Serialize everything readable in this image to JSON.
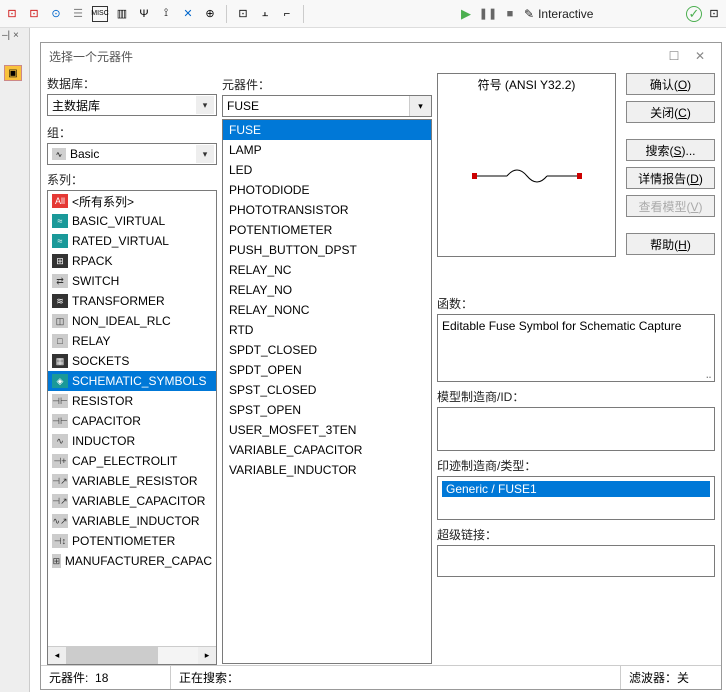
{
  "toolbar": {
    "interactive_label": "Interactive"
  },
  "dialog": {
    "title": "选择一个元器件",
    "database_label": "数据库：",
    "database_value": "主数据库",
    "group_label": "组：",
    "group_value": "Basic",
    "family_label": "系列：",
    "component_label": "元器件：",
    "component_value": "FUSE",
    "symbol_label": "符号 (ANSI Y32.2)",
    "families": [
      {
        "icon": "All",
        "cls": "red",
        "label": "<所有系列>"
      },
      {
        "icon": "≈",
        "cls": "",
        "label": "BASIC_VIRTUAL"
      },
      {
        "icon": "≈",
        "cls": "",
        "label": "RATED_VIRTUAL"
      },
      {
        "icon": "⊞",
        "cls": "dark",
        "label": "RPACK"
      },
      {
        "icon": "⇄",
        "cls": "gray",
        "label": "SWITCH"
      },
      {
        "icon": "≋",
        "cls": "dark",
        "label": "TRANSFORMER"
      },
      {
        "icon": "◫",
        "cls": "gray",
        "label": "NON_IDEAL_RLC"
      },
      {
        "icon": "□",
        "cls": "gray",
        "label": "RELAY"
      },
      {
        "icon": "▦",
        "cls": "dark",
        "label": "SOCKETS"
      },
      {
        "icon": "◈",
        "cls": "",
        "label": "SCHEMATIC_SYMBOLS",
        "selected": true
      },
      {
        "icon": "⊣⊢",
        "cls": "gray",
        "label": "RESISTOR"
      },
      {
        "icon": "⊣⊢",
        "cls": "gray",
        "label": "CAPACITOR"
      },
      {
        "icon": "∿",
        "cls": "gray",
        "label": "INDUCTOR"
      },
      {
        "icon": "⊣+",
        "cls": "gray",
        "label": "CAP_ELECTROLIT"
      },
      {
        "icon": "⊣↗",
        "cls": "gray",
        "label": "VARIABLE_RESISTOR"
      },
      {
        "icon": "⊣↗",
        "cls": "gray",
        "label": "VARIABLE_CAPACITOR"
      },
      {
        "icon": "∿↗",
        "cls": "gray",
        "label": "VARIABLE_INDUCTOR"
      },
      {
        "icon": "⊣↕",
        "cls": "gray",
        "label": "POTENTIOMETER"
      },
      {
        "icon": "⊞",
        "cls": "gray",
        "label": "MANUFACTURER_CAPAC"
      }
    ],
    "components": [
      {
        "label": "FUSE",
        "selected": true
      },
      {
        "label": "LAMP"
      },
      {
        "label": "LED"
      },
      {
        "label": "PHOTODIODE"
      },
      {
        "label": "PHOTOTRANSISTOR"
      },
      {
        "label": "POTENTIOMETER"
      },
      {
        "label": "PUSH_BUTTON_DPST"
      },
      {
        "label": "RELAY_NC"
      },
      {
        "label": "RELAY_NO"
      },
      {
        "label": "RELAY_NONC"
      },
      {
        "label": "RTD"
      },
      {
        "label": "SPDT_CLOSED"
      },
      {
        "label": "SPDT_OPEN"
      },
      {
        "label": "SPST_CLOSED"
      },
      {
        "label": "SPST_OPEN"
      },
      {
        "label": "USER_MOSFET_3TEN"
      },
      {
        "label": "VARIABLE_CAPACITOR"
      },
      {
        "label": "VARIABLE_INDUCTOR"
      }
    ],
    "function_label": "函数：",
    "function_text": "Editable Fuse Symbol for Schematic Capture",
    "model_label": "模型制造商/ID：",
    "footprint_label": "印迹制造商/类型：",
    "footprint_value": "Generic / FUSE1",
    "hyperlink_label": "超级链接："
  },
  "buttons": {
    "ok": "确认(",
    "ok_u": "O",
    "ok2": ")",
    "close": "关闭(",
    "close_u": "C",
    "close2": ")",
    "search": "搜索(",
    "search_u": "S",
    "search2": ")...",
    "detail": "详情报告(",
    "detail_u": "D",
    "detail2": ")",
    "view_model": "查看模型(",
    "view_model_u": "V",
    "view_model2": ")",
    "help": "帮助(",
    "help_u": "H",
    "help2": ")"
  },
  "status": {
    "comp_count_label": "元器件:",
    "comp_count_value": "18",
    "searching_label": "正在搜索：",
    "filter_label": "滤波器：关"
  }
}
